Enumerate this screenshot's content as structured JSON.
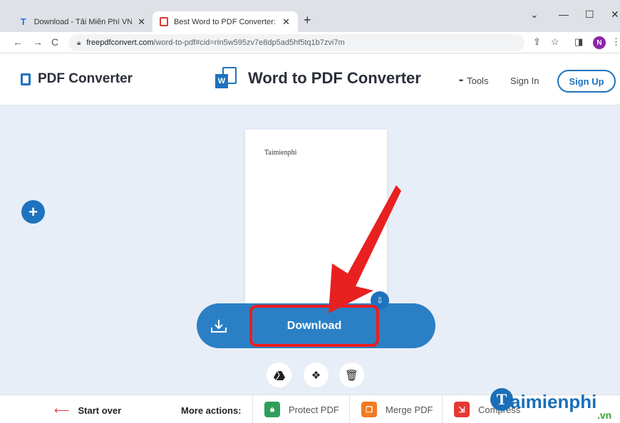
{
  "browser": {
    "tabs": [
      {
        "title": "Download - Tải Miễn Phí VN - Phần mềm",
        "icon": "taimienphi-favicon"
      },
      {
        "title": "Best Word to PDF Converter: Convert",
        "icon": "pdf-converter-favicon",
        "active": true
      }
    ],
    "new_tab": "+",
    "window_controls": [
      "⌄",
      "—",
      "☐",
      "✕"
    ],
    "url_domain": "freepdfconvert.com",
    "url_path": "/word-to-pdf#cid=rIn5w595zv7e8dp5ad5hf5tq1b7zvi7m",
    "profile_initial": "N"
  },
  "header": {
    "logo_text": "PDF Converter",
    "page_title": "Word to PDF Converter",
    "tools_label": "Tools",
    "signin_label": "Sign In",
    "signup_label": "Sign Up"
  },
  "main": {
    "preview_text": "Taimienphi",
    "download_label": "Download"
  },
  "bottom": {
    "start_over_label": "Start over",
    "more_actions_label": "More actions:",
    "actions": [
      {
        "label": "Protect PDF",
        "color": "#2e9e5b"
      },
      {
        "label": "Merge PDF",
        "color": "#f07b22"
      },
      {
        "label": "Compress",
        "color": "#e53935"
      }
    ]
  },
  "watermark": {
    "brand": "aimienphi",
    "initial": "T",
    "suffix": ".vn"
  },
  "colors": {
    "accent": "#1e73be",
    "download_bar": "#2b80c5",
    "highlight": "#ef1b1b"
  }
}
